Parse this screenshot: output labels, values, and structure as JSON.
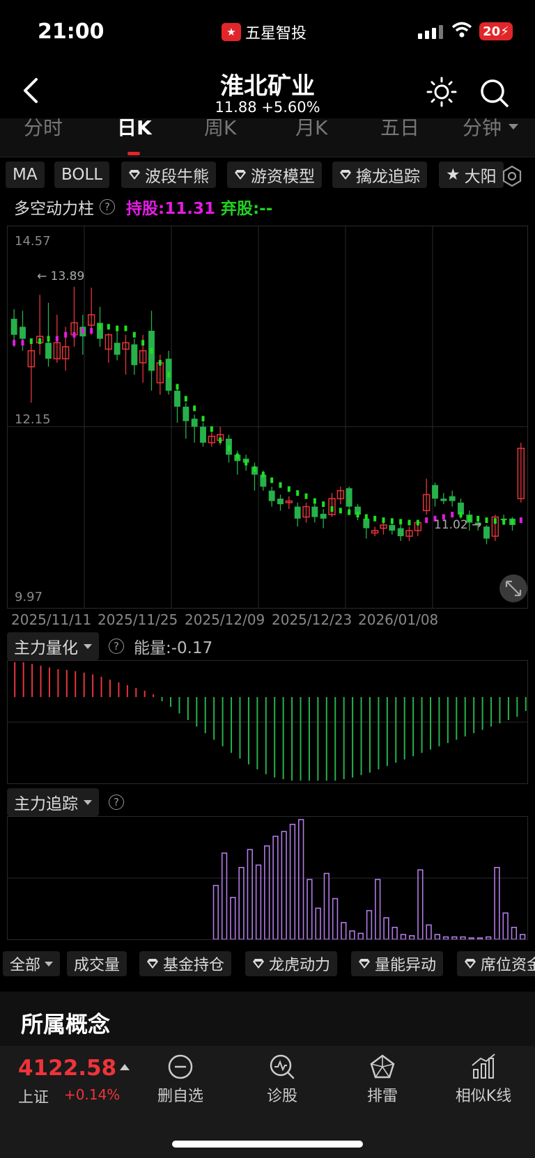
{
  "status_bar": {
    "time": "21:00",
    "app_name": "五星智投",
    "battery": "20"
  },
  "header": {
    "title": "淮北矿业",
    "price": "11.88",
    "change": "+5.60%"
  },
  "tabs": [
    {
      "label": "分时",
      "active": false
    },
    {
      "label": "日K",
      "active": true
    },
    {
      "label": "周K",
      "active": false
    },
    {
      "label": "月K",
      "active": false
    },
    {
      "label": "五日",
      "active": false
    },
    {
      "label": "分钟",
      "active": false
    }
  ],
  "indicator_chips": [
    {
      "label": "MA",
      "premium": false
    },
    {
      "label": "BOLL",
      "premium": false
    },
    {
      "label": "波段牛熊",
      "premium": true
    },
    {
      "label": "游资模型",
      "premium": true
    },
    {
      "label": "擒龙追踪",
      "premium": true
    },
    {
      "label": "大阳",
      "premium": false,
      "star": true
    }
  ],
  "power_row": {
    "label": "多空动力柱",
    "help": "?",
    "hold_text": "持股:11.31",
    "abandon_text": "弃股:--"
  },
  "main_chart": {
    "y_top_label": "14.57",
    "y_mid_label": "12.15",
    "y_bottom_label": "9.97",
    "high_annotation": "← 13.89",
    "low_annotation": "11.02 →"
  },
  "dates": [
    "2025/11/11",
    "2025/11/25",
    "2025/12/09",
    "2025/12/23",
    "2026/01/08"
  ],
  "sub1": {
    "label": "主力量化",
    "help": "?",
    "value_text": "能量:-0.17"
  },
  "sub2": {
    "label": "主力追踪",
    "help": "?"
  },
  "bottom_chips": [
    {
      "label": "全部",
      "dropdown": true,
      "premium": false
    },
    {
      "label": "成交量",
      "premium": false
    },
    {
      "label": "基金持仓",
      "premium": true
    },
    {
      "label": "龙虎动力",
      "premium": true
    },
    {
      "label": "量能异动",
      "premium": true
    },
    {
      "label": "席位资金",
      "premium": true
    }
  ],
  "concept": {
    "title": "所属概念"
  },
  "bottom_nav": {
    "index_value": "4122.58",
    "index_name": "上证",
    "index_change": "+0.14%",
    "items": [
      {
        "label": "删自选",
        "icon": "minus-circle-icon"
      },
      {
        "label": "诊股",
        "icon": "diagnose-icon"
      },
      {
        "label": "排雷",
        "icon": "mine-icon"
      },
      {
        "label": "相似K线",
        "icon": "chart-bars-icon"
      }
    ]
  },
  "colors": {
    "up": "#e8353b",
    "down": "#27b14a",
    "magenta": "#e51be5",
    "green_dot": "#1fe01f",
    "purple": "#b27be6"
  },
  "chart_data": {
    "type": "candlestick",
    "candles": [
      [
        13.5,
        13.3,
        13.62,
        13.15
      ],
      [
        13.4,
        13.25,
        13.6,
        13.1
      ],
      [
        12.9,
        13.1,
        13.2,
        12.45
      ],
      [
        13.2,
        13.28,
        13.8,
        13.05
      ],
      [
        13.2,
        13.0,
        13.7,
        12.9
      ],
      [
        13.0,
        13.2,
        13.55,
        12.95
      ],
      [
        13.0,
        13.15,
        13.4,
        12.85
      ],
      [
        13.3,
        13.45,
        13.9,
        13.15
      ],
      [
        13.4,
        13.28,
        13.55,
        13.05
      ],
      [
        13.42,
        13.55,
        13.89,
        13.3
      ],
      [
        13.45,
        13.25,
        13.65,
        13.15
      ],
      [
        13.12,
        13.3,
        13.32,
        12.95
      ],
      [
        13.2,
        13.05,
        13.4,
        12.98
      ],
      [
        13.12,
        13.2,
        13.3,
        12.8
      ],
      [
        13.18,
        12.92,
        13.25,
        12.8
      ],
      [
        12.95,
        13.1,
        13.3,
        12.7
      ],
      [
        13.35,
        12.85,
        13.6,
        12.6
      ],
      [
        12.7,
        12.95,
        13.05,
        12.55
      ],
      [
        13.0,
        12.6,
        13.1,
        12.55
      ],
      [
        12.6,
        12.4,
        12.65,
        12.2
      ],
      [
        12.4,
        12.22,
        12.45,
        12.0
      ],
      [
        12.25,
        12.15,
        12.3,
        11.95
      ],
      [
        12.15,
        11.95,
        12.2,
        11.9
      ],
      [
        11.95,
        12.03,
        12.08,
        11.9
      ],
      [
        11.98,
        12.05,
        12.15,
        11.92
      ],
      [
        12.0,
        11.8,
        12.05,
        11.7
      ],
      [
        11.8,
        11.72,
        11.85,
        11.55
      ],
      [
        11.75,
        11.7,
        11.8,
        11.6
      ],
      [
        11.65,
        11.55,
        11.7,
        11.35
      ],
      [
        11.55,
        11.4,
        11.6,
        11.35
      ],
      [
        11.35,
        11.22,
        11.4,
        11.15
      ],
      [
        11.25,
        11.18,
        11.3,
        11.1
      ],
      [
        11.2,
        11.22,
        11.28,
        11.12
      ],
      [
        11.15,
        11.0,
        11.2,
        10.9
      ],
      [
        11.02,
        11.15,
        11.2,
        10.95
      ],
      [
        11.15,
        11.02,
        11.18,
        10.95
      ],
      [
        11.06,
        11.0,
        11.12,
        10.88
      ],
      [
        11.05,
        11.25,
        11.32,
        11.02
      ],
      [
        11.25,
        11.35,
        11.4,
        11.18
      ],
      [
        11.38,
        11.15,
        11.4,
        11.1
      ],
      [
        11.15,
        11.05,
        11.18,
        10.98
      ],
      [
        11.0,
        10.88,
        11.05,
        10.75
      ],
      [
        10.82,
        10.85,
        10.9,
        10.78
      ],
      [
        10.88,
        10.92,
        10.95,
        10.8
      ],
      [
        10.92,
        10.85,
        10.98,
        10.8
      ],
      [
        10.88,
        10.78,
        10.92,
        10.72
      ],
      [
        10.78,
        10.85,
        10.9,
        10.72
      ],
      [
        10.85,
        10.95,
        10.98,
        10.78
      ],
      [
        11.1,
        11.3,
        11.5,
        11.05
      ],
      [
        11.42,
        11.25,
        11.45,
        11.15
      ],
      [
        11.25,
        11.22,
        11.32,
        11.18
      ],
      [
        11.28,
        11.22,
        11.35,
        11.15
      ],
      [
        11.2,
        11.05,
        11.25,
        11.0
      ],
      [
        11.05,
        10.95,
        11.1,
        10.85
      ],
      [
        10.95,
        10.92,
        11.0,
        10.85
      ],
      [
        10.9,
        10.75,
        10.92,
        10.68
      ],
      [
        10.78,
        11.02,
        11.05,
        10.72
      ],
      [
        11.0,
        10.98,
        11.05,
        10.92
      ],
      [
        11.0,
        10.92,
        11.02,
        10.85
      ],
      [
        11.25,
        11.88,
        11.95,
        11.2
      ]
    ],
    "sar_dots": [
      13.2,
      13.2,
      13.22,
      13.22,
      13.25,
      13.25,
      13.3,
      13.3,
      13.35,
      13.35,
      13.4,
      13.4,
      13.38,
      13.38,
      13.3,
      13.2,
      13.1,
      12.95,
      12.8,
      12.65,
      12.5,
      12.38,
      12.25,
      12.12,
      11.98,
      11.88,
      11.78,
      11.7,
      11.62,
      11.55,
      11.48,
      11.42,
      11.37,
      11.32,
      11.28,
      11.22,
      11.18,
      11.12,
      11.1,
      11.08,
      11.05,
      11.02,
      11.0,
      10.98,
      10.97,
      10.96,
      10.95,
      10.95,
      10.98,
      11.0,
      11.02,
      11.05,
      11.05,
      11.0,
      11.0,
      10.98,
      10.97,
      10.96,
      10.96,
      10.98
    ],
    "sar_colors": [
      "m",
      "m",
      "g",
      "g",
      "g",
      "m",
      "m",
      "m",
      "m",
      "m",
      "g",
      "g",
      "g",
      "g",
      "g",
      "g",
      "g",
      "g",
      "g",
      "g",
      "g",
      "g",
      "g",
      "g",
      "g",
      "g",
      "g",
      "g",
      "g",
      "g",
      "g",
      "g",
      "g",
      "g",
      "g",
      "g",
      "g",
      "g",
      "g",
      "g",
      "g",
      "g",
      "g",
      "g",
      "g",
      "g",
      "g",
      "g",
      "m",
      "m",
      "m",
      "m",
      "g",
      "g",
      "g",
      "g",
      "g",
      "g",
      "g",
      "m"
    ],
    "energy": [
      1.0,
      1.0,
      0.95,
      0.9,
      0.85,
      0.8,
      0.78,
      0.74,
      0.7,
      0.65,
      0.58,
      0.5,
      0.42,
      0.34,
      0.26,
      0.18,
      0.08,
      -0.05,
      -0.12,
      -0.2,
      -0.28,
      -0.36,
      -0.44,
      -0.52,
      -0.6,
      -0.68,
      -0.75,
      -0.82,
      -0.88,
      -0.94,
      -0.98,
      -1.0,
      -1.02,
      -1.04,
      -1.05,
      -1.05,
      -1.04,
      -1.02,
      -1.0,
      -0.98,
      -0.95,
      -0.92,
      -0.88,
      -0.84,
      -0.8,
      -0.76,
      -0.72,
      -0.68,
      -0.64,
      -0.6,
      -0.56,
      -0.52,
      -0.48,
      -0.44,
      -0.4,
      -0.36,
      -0.32,
      -0.28,
      -0.24,
      -0.17
    ],
    "tracking": [
      0,
      0,
      0,
      0,
      0,
      0,
      0,
      0,
      0,
      0,
      0,
      0,
      0,
      0,
      0,
      0,
      0,
      0,
      0,
      0,
      0,
      0,
      0,
      0,
      0.45,
      0.72,
      0.35,
      0.6,
      0.75,
      0.62,
      0.78,
      0.86,
      0.9,
      0.96,
      1.0,
      0.5,
      0.26,
      0.55,
      0.34,
      0.14,
      0.07,
      0.05,
      0.24,
      0.5,
      0.18,
      0.1,
      0.04,
      0.03,
      0.58,
      0.12,
      0.04,
      0.02,
      0.02,
      0.02,
      0.01,
      0.01,
      0.02,
      0.6,
      0.22,
      0.1,
      0.04
    ],
    "ylim": [
      9.97,
      14.57
    ]
  }
}
